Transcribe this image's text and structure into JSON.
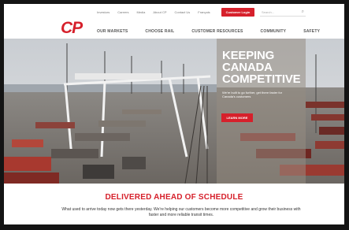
{
  "utility_nav": {
    "links": [
      "Investors",
      "Careers",
      "Media",
      "About CP",
      "Contact Us",
      "Français"
    ],
    "login_label": "Customer Login",
    "search_placeholder": "Search..."
  },
  "logo": {
    "text": "CP"
  },
  "main_nav": [
    "OUR MARKETS",
    "CHOOSE RAIL",
    "CUSTOMER RESOURCES",
    "COMMUNITY",
    "SAFETY"
  ],
  "hero": {
    "title": "KEEPING\nCANADA\nCOMPETITIVE",
    "subtitle": "We're built to go further, get there faster for Canada's customers",
    "button_label": "LEARN MORE"
  },
  "tagline": "DELIVERED AHEAD OF SCHEDULE",
  "blurb": "What used to arrive today now gets there yesterday. We're helping our customers become more competitive and grow their business with faster and more reliable transit times.",
  "colors": {
    "brand_red": "#d6202b",
    "frame": "#141414"
  }
}
